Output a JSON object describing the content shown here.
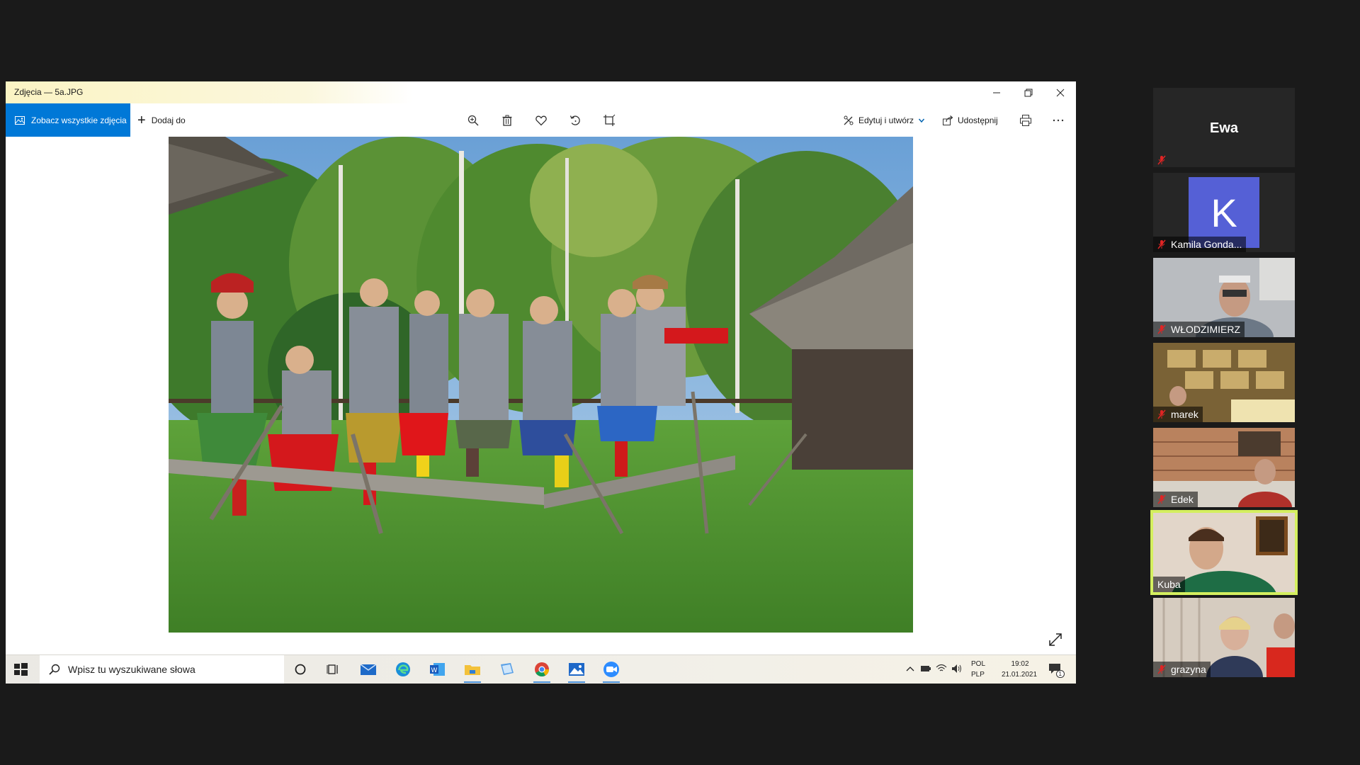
{
  "window": {
    "title": "Zdjęcia — 5a.JPG",
    "controls": [
      "minimize",
      "restore",
      "close"
    ]
  },
  "toolbar": {
    "see_all_label": "Zobacz wszystkie zdjęcia",
    "add_to_label": "Dodaj do",
    "edit_create_label": "Edytuj i utwórz",
    "share_label": "Udostępnij",
    "tools": [
      "zoom-icon",
      "delete-icon",
      "heart-icon",
      "rotate-icon",
      "crop-icon"
    ],
    "accent": "#0078d7"
  },
  "taskbar": {
    "search_placeholder": "Wpisz tu wyszukiwane słowa",
    "lang_top": "POL",
    "lang_bottom": "PLP",
    "time": "19:02",
    "date": "21.01.2021",
    "notification_count": "1"
  },
  "participants": [
    {
      "name": "Ewa",
      "display": "Ewa",
      "muted": true,
      "video": false
    },
    {
      "name": "Kamila Gonda...",
      "initial": "K",
      "muted": true,
      "video": false
    },
    {
      "name": "WŁODZIMIERZ",
      "muted": true,
      "video": true
    },
    {
      "name": "marek",
      "muted": true,
      "video": true
    },
    {
      "name": "Edek",
      "muted": true,
      "video": true
    },
    {
      "name": "Kuba",
      "muted": false,
      "video": true,
      "active_speaker": true
    },
    {
      "name": "grazyna",
      "muted": true,
      "video": true
    }
  ],
  "colors": {
    "active_speaker_border": "#d4ef5f",
    "avatar_bg": "#5560d6",
    "muted_mic": "#e02424"
  }
}
